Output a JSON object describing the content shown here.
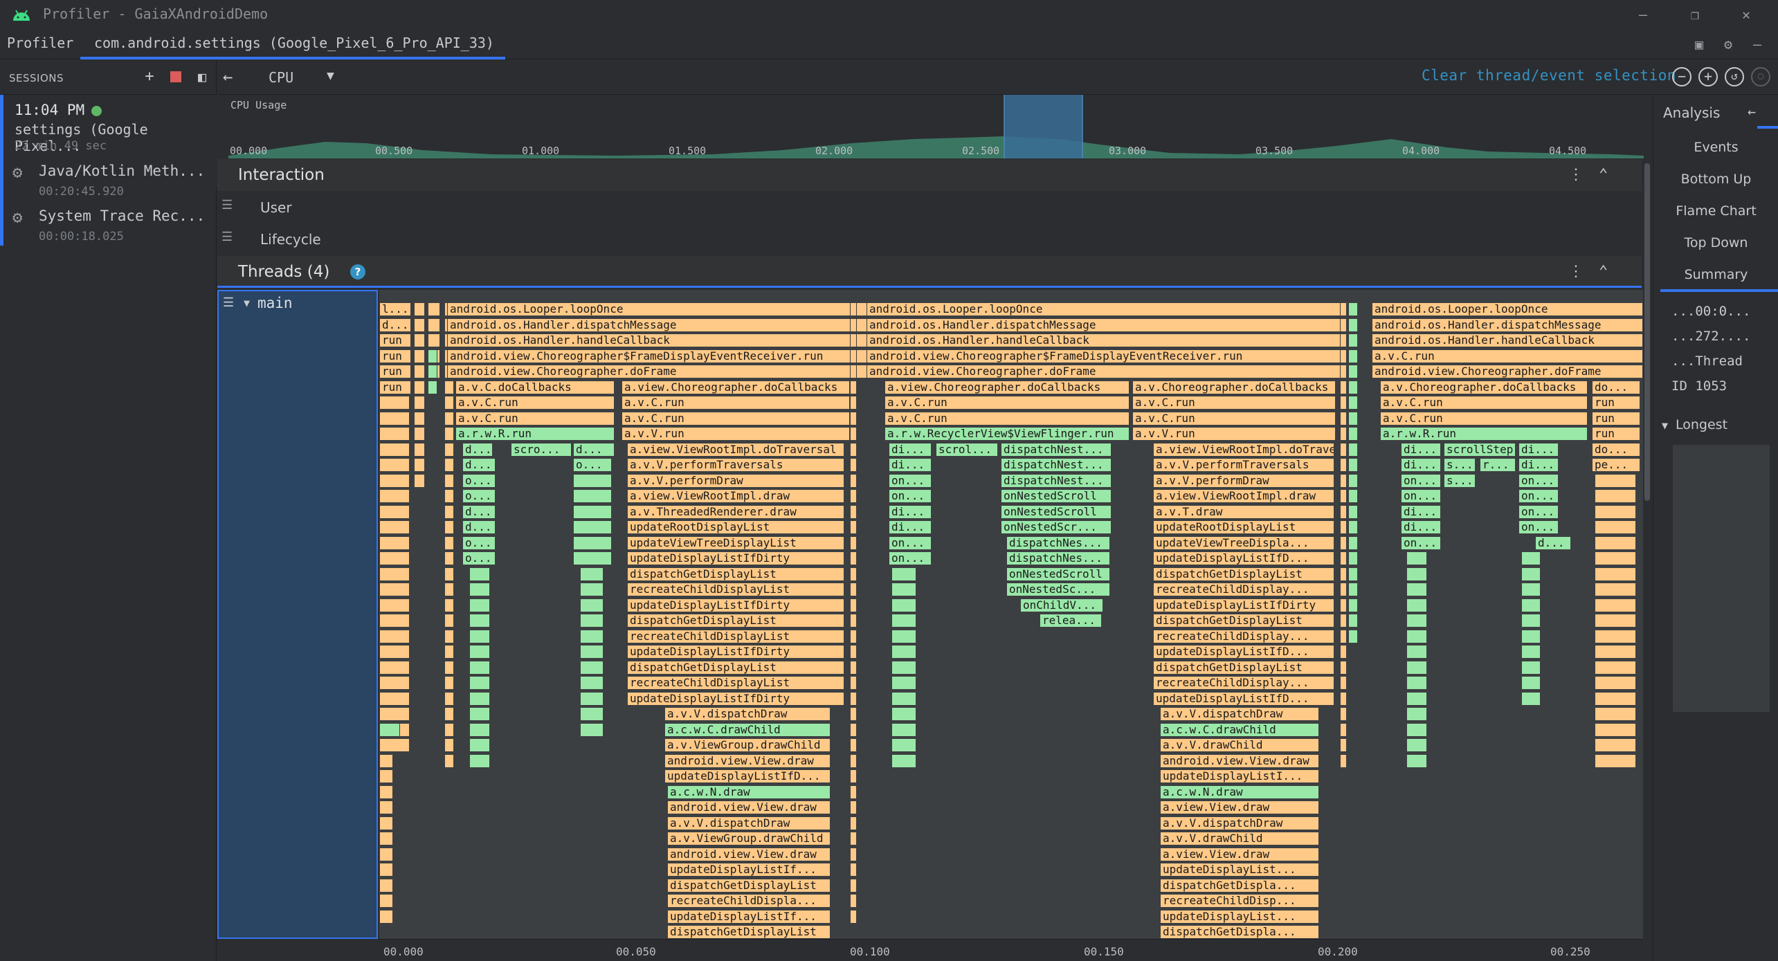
{
  "window": {
    "title": "Profiler - GaiaXAndroidDemo"
  },
  "tabs": {
    "profiler": "Profiler",
    "session_tab": "com.android.settings (Google_Pixel_6_Pro_API_33)"
  },
  "sessions": {
    "header": "SESSIONS",
    "current": {
      "time": "11:04 PM",
      "name": "settings (Google Pixel...",
      "duration": "22 min 49 sec"
    },
    "recordings": [
      {
        "name": "Java/Kotlin Meth...",
        "time": "00:20:45.920"
      },
      {
        "name": "System Trace Rec...",
        "time": "00:00:18.025"
      }
    ]
  },
  "toolbar": {
    "profiler_select": "CPU",
    "clear_link": "Clear thread/event selection"
  },
  "cpu_usage": {
    "label": "CPU Usage",
    "ticks": [
      "00.000",
      "00.500",
      "01.000",
      "01.500",
      "02.000",
      "02.500",
      "03.000",
      "03.500",
      "04.000",
      "04.500"
    ]
  },
  "interaction": {
    "title": "Interaction",
    "lanes": [
      "User",
      "Lifecycle"
    ]
  },
  "threads": {
    "title": "Threads (4)",
    "help": "?",
    "thread_name": "main"
  },
  "flame_text": {
    "c1": [
      "l...",
      "d...",
      "run",
      "run",
      "run",
      "run"
    ],
    "c2": [
      "android.os.Looper.loopOnce",
      "android.os.Handler.dispatchMessage",
      "android.os.Handler.handleCallback",
      "android.view.Choreographer$FrameDisplayEventReceiver.run",
      "android.view.Choreographer.doFrame"
    ],
    "c2a": [
      "a.v.C.doCallbacks",
      "a.v.C.run",
      "a.v.C.run",
      "a.r.w.R.run"
    ],
    "c2a_sub": [
      "d...",
      "scro...",
      "d...",
      "d...",
      "o...",
      "o...",
      "d...",
      "d...",
      "o...",
      "o...",
      "o..."
    ],
    "c2b": [
      "a.view.Choreographer.doCallbacks",
      "a.v.C.run",
      "a.v.C.run",
      "a.v.V.run",
      "a.view.ViewRootImpl.doTraversal",
      "a.v.V.performTraversals",
      "a.v.V.performDraw",
      "a.view.ViewRootImpl.draw",
      "a.v.ThreadedRenderer.draw",
      "updateRootDisplayList",
      "updateViewTreeDisplayList",
      "updateDisplayListIfDirty",
      "dispatchGetDisplayList",
      "recreateChildDisplayList",
      "updateDisplayListIfDirty",
      "dispatchGetDisplayList",
      "recreateChildDisplayList",
      "updateDisplayListIfDirty",
      "dispatchGetDisplayList",
      "recreateChildDisplayList",
      "updateDisplayListIfDirty",
      "a.v.V.dispatchDraw",
      "a.c.w.C.drawChild",
      "a.v.ViewGroup.drawChild",
      "android.view.View.draw",
      "updateDisplayListIfD...",
      "a.c.w.N.draw",
      "android.view.View.draw",
      "a.v.V.dispatchDraw",
      "a.v.ViewGroup.drawChild",
      "android.view.View.draw",
      "updateDisplayListIf...",
      "dispatchGetDisplayList",
      "recreateChildDispla...",
      "updateDisplayListIf...",
      "dispatchGetDisplayList"
    ],
    "c3": [
      "android.os.Looper.loopOnce",
      "android.os.Handler.dispatchMessage",
      "android.os.Handler.handleCallback",
      "android.view.Choreographer$FrameDisplayEventReceiver.run",
      "android.view.Choreographer.doFrame"
    ],
    "c3a": [
      "a.view.Choreographer.doCallbacks",
      "a.v.C.run",
      "a.v.C.run",
      "a.r.w.RecyclerView$ViewFlinger.run"
    ],
    "c3a_sub": [
      "di...",
      "scrol...",
      "dispatchNest...",
      "di...",
      "dispatchNest...",
      "on...",
      "dispatchNest...",
      "on...",
      "onNestedScroll",
      "di...",
      "onNestedScroll",
      "di...",
      "onNestedScr...",
      "on...",
      "dispatchNes...",
      "on...",
      "dispatchNes...",
      "onNestedScroll",
      "onNestedSc...",
      "onChildV...",
      "relea..."
    ],
    "c3b": [
      "a.v.Choreographer.doCallbacks",
      "a.v.C.run",
      "a.v.C.run",
      "a.v.V.run",
      "a.view.ViewRootImpl.doTraversal",
      "a.v.V.performTraversals",
      "a.v.V.performDraw",
      "a.view.ViewRootImpl.draw",
      "a.v.T.draw",
      "updateRootDisplayList",
      "updateViewTreeDispla...",
      "updateDisplayListIfD...",
      "dispatchGetDisplayList",
      "recreateChildDisplay...",
      "updateDisplayListIfDirty",
      "dispatchGetDisplayList",
      "recreateChildDisplay...",
      "updateDisplayListIfD...",
      "dispatchGetDisplayList",
      "recreateChildDisplay...",
      "updateDisplayListIfD...",
      "a.v.V.dispatchDraw",
      "a.c.w.C.drawChild",
      "a.v.V.drawChild",
      "android.view.View.draw",
      "updateDisplayListI...",
      "a.c.w.N.draw",
      "a.view.View.draw",
      "a.v.V.dispatchDraw",
      "a.v.V.drawChild",
      "a.view.View.draw",
      "updateDisplayList...",
      "dispatchGetDispla...",
      "recreateChildDisp...",
      "updateDisplayList...",
      "dispatchGetDispla..."
    ],
    "c4": [
      "android.os.Looper.loopOnce",
      "android.os.Handler.dispatchMessage",
      "android.os.Handler.handleCallback",
      "a.v.C.run",
      "android.view.Choreographer.doFrame"
    ],
    "c4a": [
      "a.v.Choreographer.doCallbacks",
      "a.v.C.run",
      "a.v.C.run",
      "a.r.w.R.run"
    ],
    "c4a_sub": [
      "di...",
      "scrollStep",
      "di...",
      "di...",
      "s...",
      "r...",
      "di...",
      "on...",
      "s...",
      "on...",
      "on...",
      "on...",
      "di...",
      "on...",
      "di...",
      "on...",
      "on...",
      "d..."
    ],
    "c4b": [
      "do...",
      "run",
      "run",
      "run",
      "do...",
      "pe..."
    ]
  },
  "bottom_axis": [
    "00.000",
    "00.050",
    "00.100",
    "00.150",
    "00.200",
    "00.250"
  ],
  "analysis": {
    "title": "Analysis",
    "tabs": [
      "Events",
      "Bottom Up",
      "Flame Chart",
      "Top Down",
      "Summary"
    ],
    "values": [
      "...00:0...",
      "...272....",
      "...Thread",
      "ID 1053"
    ],
    "longest": "Longest"
  },
  "colors": {
    "accent": "#3574f0",
    "flame_orange": "#ffc987",
    "flame_green": "#99e8a8",
    "recording_dot": "#5fb865",
    "stop_red": "#db5c5c"
  }
}
